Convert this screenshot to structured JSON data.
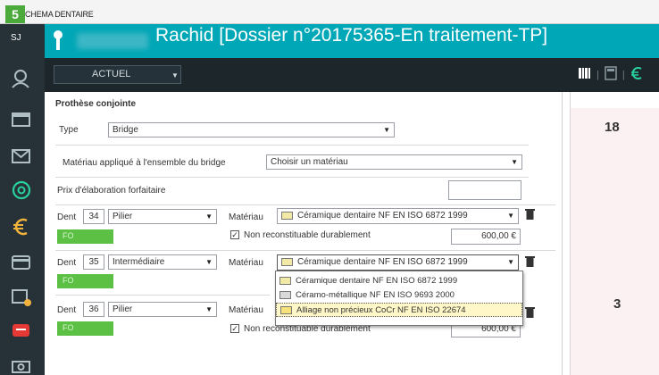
{
  "window": {
    "step": "5",
    "title": "CHEMA DENTAIRE"
  },
  "header": {
    "initials": "SJ",
    "title": "Rachid [Dossier n°20175365-En traitement-TP]"
  },
  "toolbar": {
    "view_select": "ACTUEL"
  },
  "right_panel": {
    "top_number": "18",
    "bottom_number": "3"
  },
  "form": {
    "section_title": "Prothèse conjointe",
    "type_label": "Type",
    "type_value": "Bridge",
    "material_all_label": "Matériau appliqué à l'ensemble du bridge",
    "material_all_value": "Choisir un matériau",
    "price_label": "Prix d'élaboration forfaitaire",
    "price_value": "",
    "rows": [
      {
        "dent_label": "Dent",
        "dent": "34",
        "role": "Pilier",
        "mat_label": "Matériau",
        "material": "Céramique dentaire NF EN ISO 6872 1999",
        "code": "FO",
        "checkbox_label": "Non reconstituable durablement",
        "amount": "600,00 €"
      },
      {
        "dent_label": "Dent",
        "dent": "35",
        "role": "Intermédiaire",
        "mat_label": "Matériau",
        "material": "Céramique dentaire NF EN ISO 6872 1999",
        "code": "FO"
      },
      {
        "dent_label": "Dent",
        "dent": "36",
        "role": "Pilier",
        "mat_label": "Matériau",
        "code": "FO",
        "checkbox_label": "Non reconstituable durablement",
        "amount": "600,00 €"
      }
    ],
    "dropdown_options": [
      "Céramique dentaire NF EN ISO 6872 1999",
      "Céramo-métallique NF EN ISO 9693 2000",
      "Alliage non précieux CoCr NF EN ISO 22674"
    ]
  },
  "icons": [
    "user-icon",
    "agenda-icon",
    "mail-icon",
    "at-icon",
    "euro-icon",
    "card-icon",
    "calendar-euro-icon",
    "chat-icon",
    "camera-icon",
    "barcode-icon",
    "calculator-icon"
  ],
  "colors": {
    "teal": "#00a7b7",
    "sidebar": "#263238",
    "green": "#5cc044",
    "badge": "#4caa3c"
  }
}
